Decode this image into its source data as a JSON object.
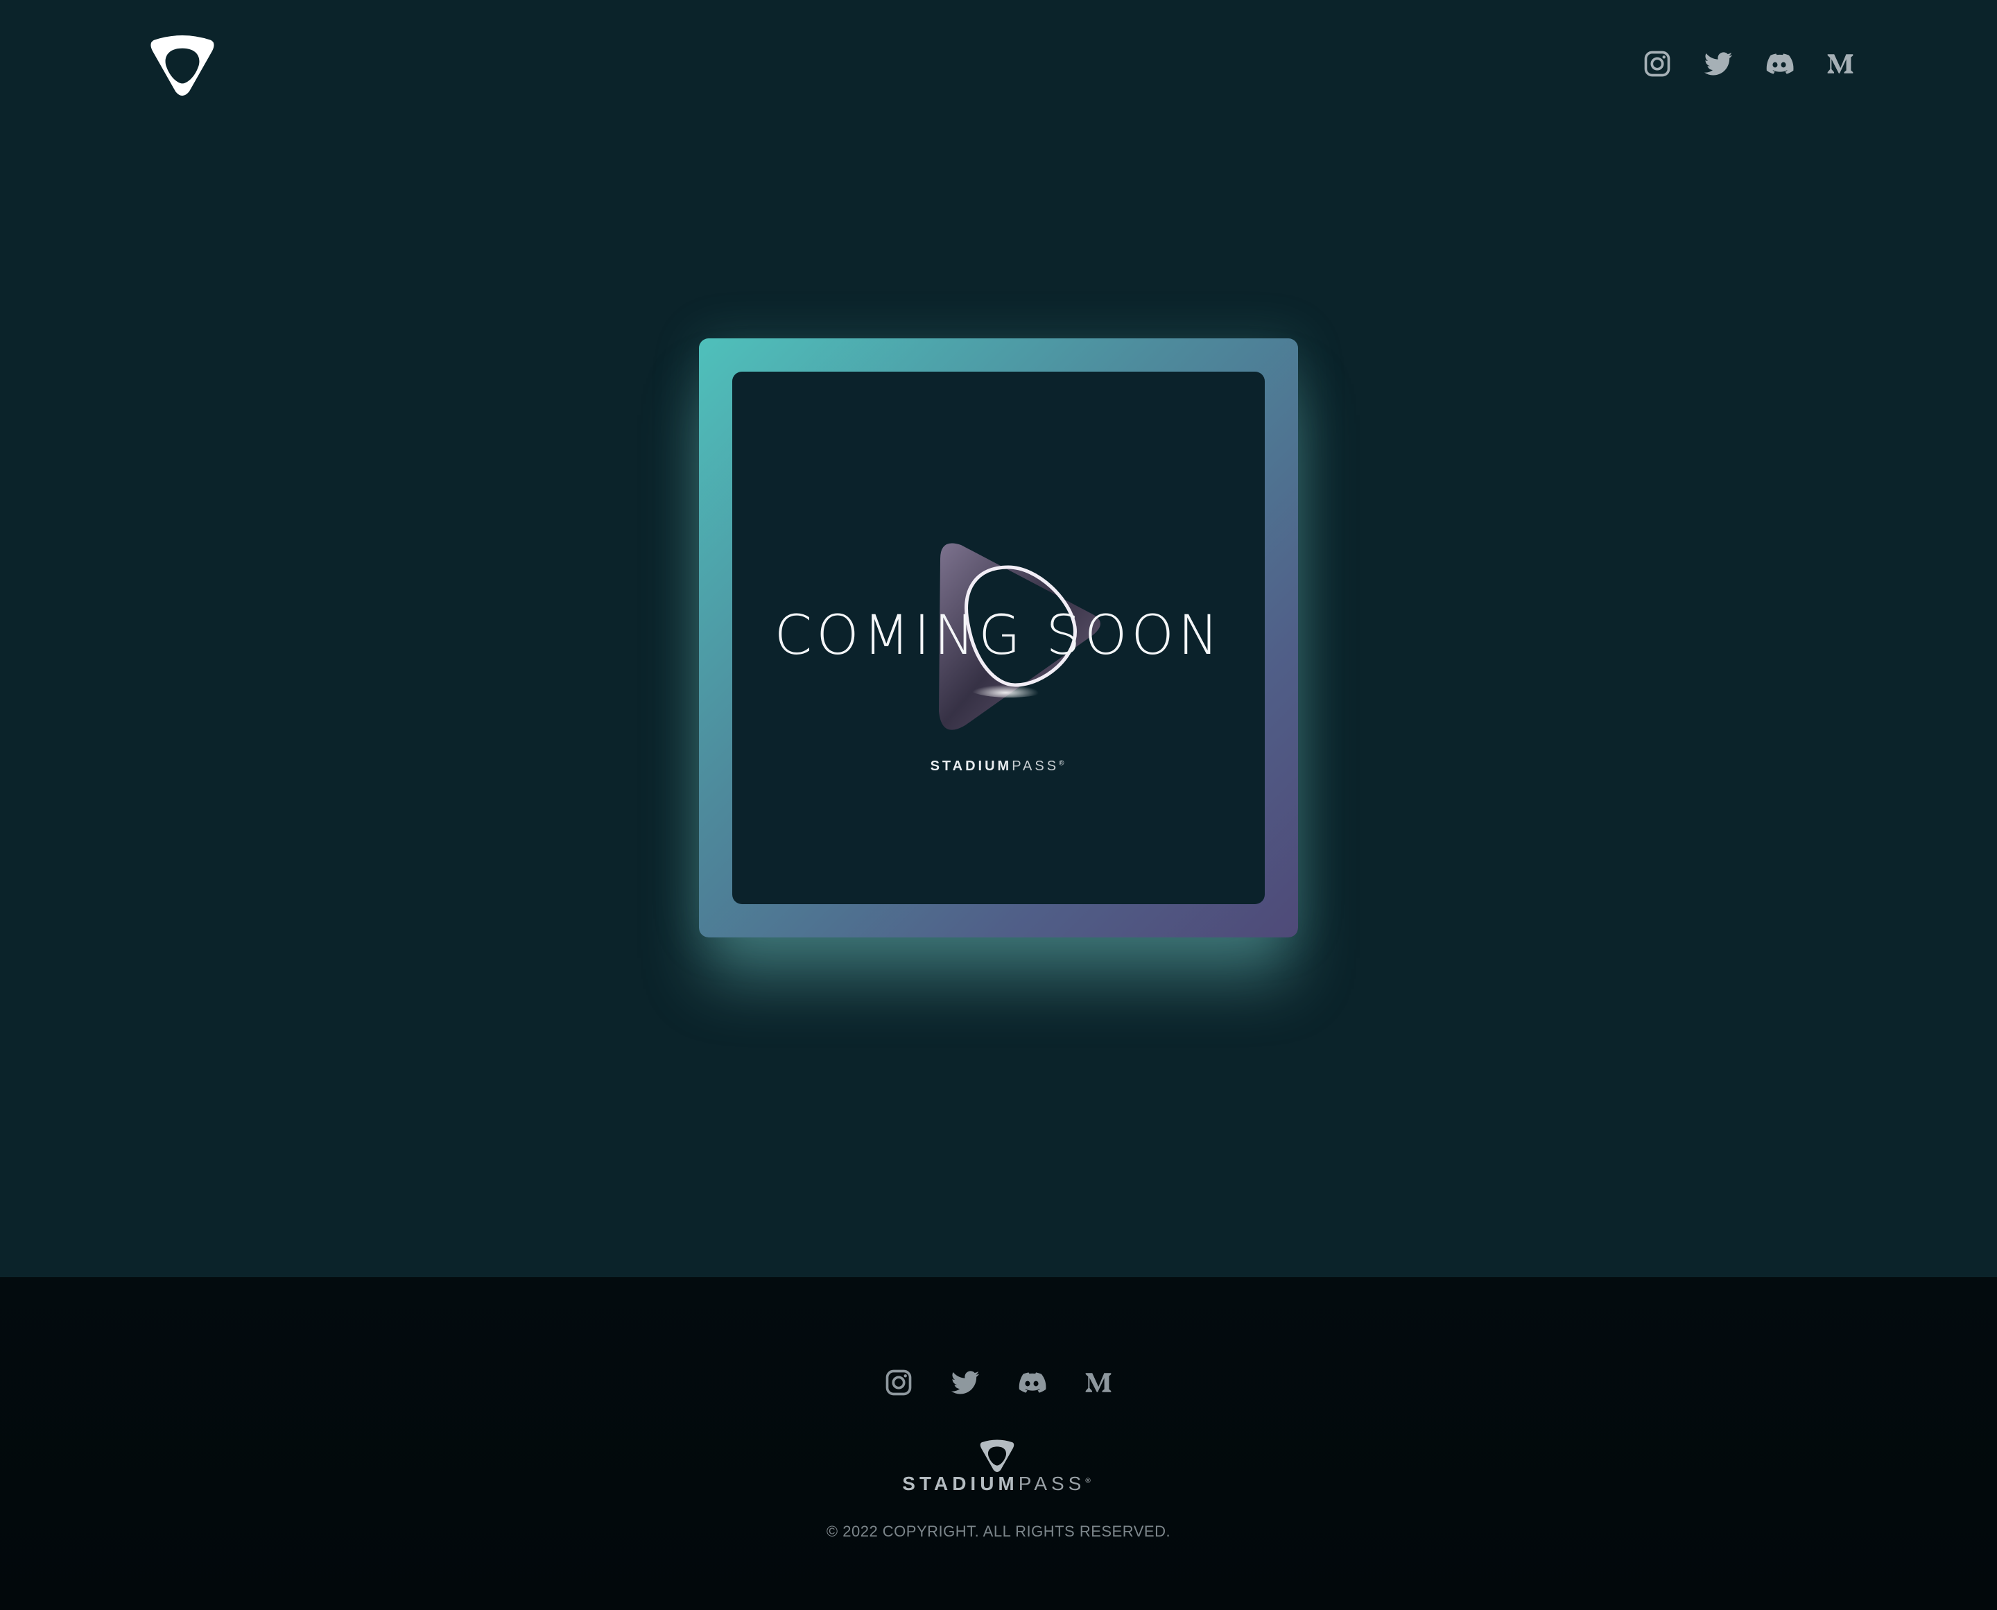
{
  "header": {
    "logo_icon": "stadiumpass-logo-icon",
    "social": [
      {
        "name": "instagram",
        "icon": "instagram-icon"
      },
      {
        "name": "twitter",
        "icon": "twitter-icon"
      },
      {
        "name": "discord",
        "icon": "discord-icon"
      },
      {
        "name": "medium",
        "icon": "medium-icon"
      }
    ]
  },
  "hero": {
    "heading": "COMING SOON",
    "wordmark_bold": "STADIUM",
    "wordmark_light": "PASS",
    "wordmark_mark": "®"
  },
  "footer": {
    "social": [
      {
        "name": "instagram",
        "icon": "instagram-icon"
      },
      {
        "name": "twitter",
        "icon": "twitter-icon"
      },
      {
        "name": "discord",
        "icon": "discord-icon"
      },
      {
        "name": "medium",
        "icon": "medium-icon"
      }
    ],
    "wordmark_bold": "STADIUM",
    "wordmark_light": "PASS",
    "wordmark_mark": "®",
    "copyright": "© 2022 COPYRIGHT. ALL RIGHTS RESERVED."
  },
  "colors": {
    "background": "#0b232a",
    "footer_background": "#02080b",
    "frame_gradient_start": "#4fc0bb",
    "frame_gradient_end": "#4f4a78",
    "icon_color": "#a6b0b6"
  }
}
